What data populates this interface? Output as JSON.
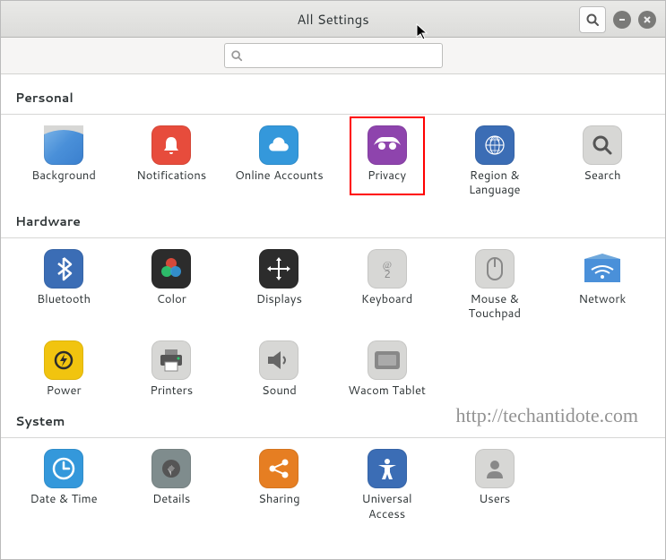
{
  "window": {
    "title": "All Settings"
  },
  "search": {
    "placeholder": ""
  },
  "watermark": "http://techantidote.com",
  "sections": {
    "personal": {
      "header": "Personal",
      "items": [
        {
          "id": "background",
          "label": "Background"
        },
        {
          "id": "notifications",
          "label": "Notifications"
        },
        {
          "id": "online-accounts",
          "label": "Online Accounts"
        },
        {
          "id": "privacy",
          "label": "Privacy",
          "highlighted": true
        },
        {
          "id": "region-language",
          "label": "Region & Language"
        },
        {
          "id": "search",
          "label": "Search"
        }
      ]
    },
    "hardware": {
      "header": "Hardware",
      "items": [
        {
          "id": "bluetooth",
          "label": "Bluetooth"
        },
        {
          "id": "color",
          "label": "Color"
        },
        {
          "id": "displays",
          "label": "Displays"
        },
        {
          "id": "keyboard",
          "label": "Keyboard"
        },
        {
          "id": "mouse-touchpad",
          "label": "Mouse & Touchpad"
        },
        {
          "id": "network",
          "label": "Network"
        },
        {
          "id": "power",
          "label": "Power"
        },
        {
          "id": "printers",
          "label": "Printers"
        },
        {
          "id": "sound",
          "label": "Sound"
        },
        {
          "id": "wacom-tablet",
          "label": "Wacom Tablet"
        }
      ]
    },
    "system": {
      "header": "System",
      "items": [
        {
          "id": "date-time",
          "label": "Date & Time"
        },
        {
          "id": "details",
          "label": "Details"
        },
        {
          "id": "sharing",
          "label": "Sharing"
        },
        {
          "id": "universal-access",
          "label": "Universal Access"
        },
        {
          "id": "users",
          "label": "Users"
        }
      ]
    }
  }
}
